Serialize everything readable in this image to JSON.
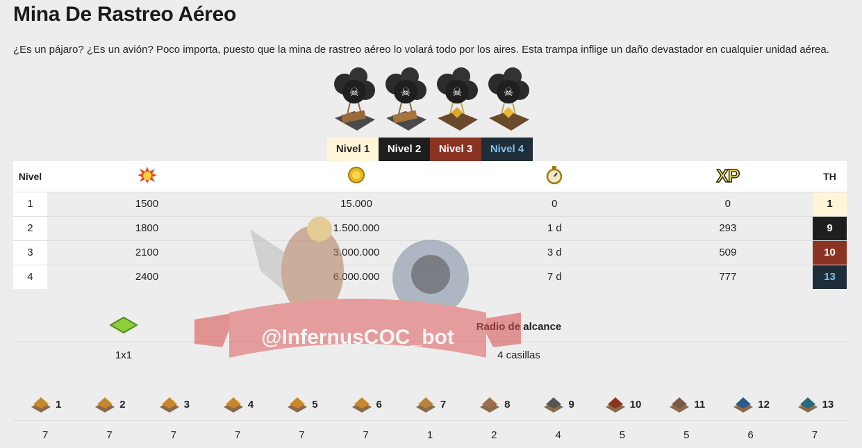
{
  "title": "Mina De Rastreo Aéreo",
  "description": "¿Es un pájaro? ¿Es un avión? Poco importa, puesto que la mina de rastreo aéreo lo volará todo por los aires. Esta trampa inflige un daño devastador en cualquier unidad aérea.",
  "level_tabs": [
    "Nivel 1",
    "Nivel 2",
    "Nivel 3",
    "Nivel 4"
  ],
  "table": {
    "headers": {
      "level": "Nivel",
      "damage_icon": "explosion-icon",
      "cost_icon": "gold-coin-icon",
      "time_icon": "stopwatch-icon",
      "xp": "XP",
      "th": "TH"
    },
    "rows": [
      {
        "level": "1",
        "damage": "1500",
        "cost": "15.000",
        "time": "0",
        "xp": "0",
        "th": "1"
      },
      {
        "level": "2",
        "damage": "1800",
        "cost": "1.500.000",
        "time": "1 d",
        "xp": "293",
        "th": "9"
      },
      {
        "level": "3",
        "damage": "2100",
        "cost": "3.000.000",
        "time": "3 d",
        "xp": "509",
        "th": "10"
      },
      {
        "level": "4",
        "damage": "2400",
        "cost": "6.000.000",
        "time": "7 d",
        "xp": "777",
        "th": "13"
      }
    ]
  },
  "size": {
    "icon": "grass-tile-icon",
    "size_value": "1x1",
    "range_label": "Radio de alcance",
    "range_value": "4 casillas"
  },
  "watermark": "@InfernusCOC_bot",
  "town_halls": {
    "levels": [
      "1",
      "2",
      "3",
      "4",
      "5",
      "6",
      "7",
      "8",
      "9",
      "10",
      "11",
      "12",
      "13"
    ],
    "counts": [
      "7",
      "7",
      "7",
      "7",
      "7",
      "7",
      "1",
      "2",
      "4",
      "5",
      "5",
      "6",
      "7"
    ]
  },
  "colors": {
    "th1": "#fff5d8",
    "th9": "#1e1e1e",
    "th10": "#8a3323",
    "th13": "#1f2d38",
    "th13_text": "#7ec3ea"
  }
}
